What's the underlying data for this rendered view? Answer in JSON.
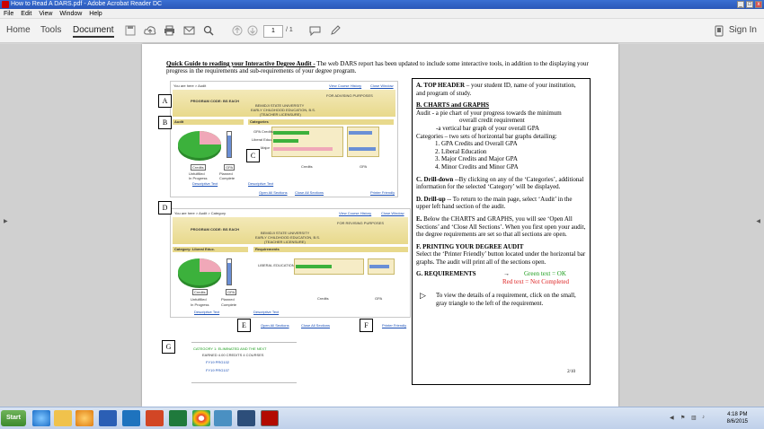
{
  "window": {
    "title": "How to Read A DARS.pdf - Adobe Acrobat Reader DC",
    "btn_min": "_",
    "btn_max": "□",
    "btn_close": "x"
  },
  "menu": [
    "File",
    "Edit",
    "View",
    "Window",
    "Help"
  ],
  "toolbar": {
    "tabs": [
      "Home",
      "Tools",
      "Document"
    ],
    "page_current": "1",
    "page_total": "/ 1",
    "sign_in": "Sign In"
  },
  "document": {
    "heading_bold": "Quick Guide to reading your Interactive Degree Audit -",
    "heading_rest": " The web DARS report has been updated to include some interactive tools, in addition to the displaying your progress in the requirements and sub-requirements of your degree program.",
    "callouts": [
      "A",
      "B",
      "C",
      "D",
      "E",
      "F",
      "G"
    ],
    "sections": {
      "a_title": "A. TOP HEADER",
      "a_text": " – your student ID, name of your institution,  and program of study.",
      "b_title": "B. CHARTS and GRAPHS",
      "b_audit": "Audit  - a pie chart of your progress towards the minimum",
      "b_audit2": "overall credit requirement",
      "b_audit3": "-a vertical bar graph of your overall GPA",
      "b_categories": "Categories – two sets of horizontal bar graphs detailing:",
      "b_list": [
        "GPA Credits and Overall GPA",
        "Liberal Education",
        "Major Credits and Major GPA",
        "Minor Credits and Minor GPA"
      ],
      "c_title": "C.  Drill-down",
      "c_text": " --By clicking on any of the ‘Categories’, additional information for the selected ‘Category’ will be displayed.",
      "d_title": "D. Drill-up",
      "d_text": " -- To return to the main page, select ‘Audit’ in the upper left hand section of the audit.",
      "e_title": "E.",
      "e_text": " Below the CHARTS and GRAPHS, you will see ‘Open All Sections’ and ‘Close All Sections’.  When you first open your audit, the degree requirements are set so that all sections are open.",
      "f_title": "F. PRINTING YOUR DEGREE AUDIT",
      "f_text": "Select the ‘Printer Friendly’ button located under the horizontal bar graphs.  The audit will print all of the sections open.",
      "g_title": "G. REQUIREMENTS",
      "g_arrow": "→",
      "g_green": "Green text  = OK",
      "g_red": "Red text = Not Completed",
      "g_last": "To view the details of a requirement, click on the small, gray triangle to the left of the requirement.",
      "page_num": "2/10"
    },
    "mock1": {
      "youarehere": "You are here > Audit",
      "view_history": "View Course History",
      "close_window": "Close Window",
      "program_code": "PROGRAM CODE: BS EACH",
      "advising": "FOR ADVISING PURPOSES",
      "school": "BEMIDJI STATE UNIVERSITY",
      "degree": "EARLY CHILDHOOD EDUCATION, B.S.",
      "license": "(TEACHER LICENSURE)",
      "audit_tab": "Audit",
      "categories_tab": "Categories",
      "cat_rows": [
        "GPA Credits",
        "Liberal Educ.",
        "Major"
      ],
      "credits": "Credits",
      "gpa": "GPA",
      "gpa_lbl": "GPA",
      "credits_lbl": "Credits",
      "legend": [
        "Unfulfilled",
        "Planned",
        "In Progress",
        "Complete"
      ],
      "desc1": "Descriptive Text",
      "desc2": "Descriptive Text",
      "open_all": "Open All Sections",
      "close_all": "Close All Sections",
      "printer": "Printer Friendly"
    },
    "mock2": {
      "youarehere": "You are here > Audit > Category",
      "view_history": "View Course History",
      "close_window": "Close Window",
      "program_code": "PROGRAM CODE: BS EACH",
      "advising": "FOR REVISING PURPOSES",
      "school": "BEMIDJI STATE UNIVERSITY",
      "degree": "EARLY CHILDHOOD EDUCATION, B.S.",
      "license": "(TEACHER LICENSURE)",
      "category_tab": "Category: Liberal Educ.",
      "requirements_tab": "Requirements",
      "row": "LIBERAL EDUCATION",
      "credits": "Credits",
      "gpa": "GPA",
      "credits_lbl": "Credits",
      "gpa_lbl": "GPA",
      "legend": [
        "Unfulfilled",
        "Planned",
        "In Progress",
        "Complete"
      ],
      "desc1": "Descriptive Text",
      "desc2": "Descriptive Text",
      "open_all": "Open All Sections",
      "close_all": "Close All Sections",
      "printer": "Printer Friendly"
    },
    "mock3": {
      "line1": "CATEGORY 1: ELIMINATED AND THE NEXT",
      "line2": "EARNED  4.00 CREDITS  4 COURSES",
      "line3": "FY19 PRG102",
      "line4": "FY19 PRG107"
    }
  },
  "taskbar": {
    "start": "Start",
    "time": "4:18 PM",
    "date": "8/6/2015"
  },
  "colors": {
    "accent_green": "#1a9c1a",
    "accent_red": "#d22",
    "title_blue": "#2a57b8"
  }
}
